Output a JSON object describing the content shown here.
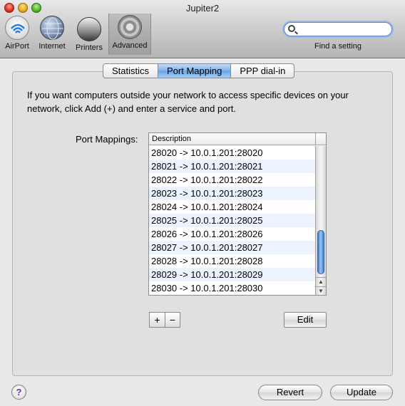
{
  "window": {
    "title": "Jupiter2"
  },
  "toolbar": {
    "items": [
      {
        "label": "AirPort",
        "icon": "airport-icon"
      },
      {
        "label": "Internet",
        "icon": "globe-icon"
      },
      {
        "label": "Printers",
        "icon": "printer-icon"
      },
      {
        "label": "Advanced",
        "icon": "gear-icon",
        "selected": true
      }
    ],
    "search": {
      "value": "",
      "placeholder": "",
      "caption": "Find a setting"
    }
  },
  "tabs": [
    {
      "label": "Statistics",
      "active": false
    },
    {
      "label": "Port Mapping",
      "active": true
    },
    {
      "label": "PPP dial-in",
      "active": false
    }
  ],
  "intro_text": "If you want computers outside your network to access specific devices on your network, click Add (+) and enter a service and port.",
  "port_mappings": {
    "label": "Port Mappings:",
    "column_header": "Description",
    "rows": [
      "28020 -> 10.0.1.201:28020",
      "28021 -> 10.0.1.201:28021",
      "28022 -> 10.0.1.201:28022",
      "28023 -> 10.0.1.201:28023",
      "28024 -> 10.0.1.201:28024",
      "28025 -> 10.0.1.201:28025",
      "28026 -> 10.0.1.201:28026",
      "28027 -> 10.0.1.201:28027",
      "28028 -> 10.0.1.201:28028",
      "28029 -> 10.0.1.201:28029",
      "28030 -> 10.0.1.201:28030"
    ],
    "add_label": "+",
    "remove_label": "−",
    "edit_label": "Edit"
  },
  "footer": {
    "help_label": "?",
    "revert_label": "Revert",
    "update_label": "Update"
  },
  "colors": {
    "selected_tab": "#7fb1e8",
    "scroll_thumb": "#3f7ed2",
    "row_stripe": "#edf3fe"
  }
}
